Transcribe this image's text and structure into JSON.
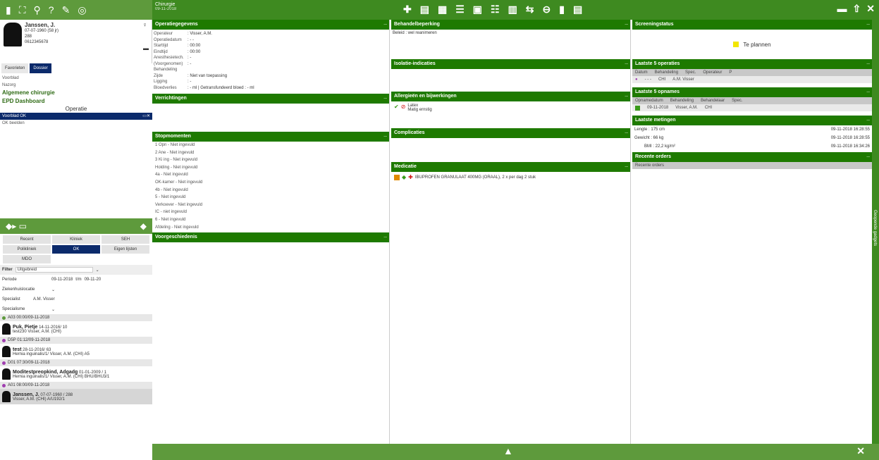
{
  "header": {
    "module": "Chirurgie",
    "date": "09-11-2018"
  },
  "patient": {
    "name": "Janssen, J.",
    "dob": "07-07-1960 (58 jr)",
    "bed": "288",
    "phone": "0612345678"
  },
  "left_tabs": [
    "Favorieten",
    "Dossier"
  ],
  "left_nav": {
    "items": [
      "Voorblad",
      "Nazorg"
    ],
    "sections": [
      "Algemene chirurgie",
      "EPD Dashboard"
    ],
    "section_title": "Operatie",
    "selected": "Voorblad OK",
    "sub_item": "OK beelden"
  },
  "worklist_buttons": [
    "Recent",
    "Kliniek",
    "SEH",
    "Polikliniek",
    "OK",
    "Eigen lijsten",
    "MDO"
  ],
  "filter": {
    "label": "Filter",
    "value": "Uitgebreid",
    "periode_label": "Periode",
    "periode_from": "09-11-2018",
    "periode_to_label": "t/m",
    "periode_to": "09-11-20",
    "location_label": "Ziekenhuislocatie",
    "specialist_label": "Specialist",
    "specialist_value": "A.M. Visser",
    "specialisme_label": "Specialisme"
  },
  "patient_list": [
    {
      "group": "A03 00:00/09-11-2018",
      "name": "Puk, Pietje",
      "extra": "14-11-2016/ 10",
      "sub": "test230 Visser, A.M. (CHI)"
    },
    {
      "group": "D5P 01:12/09-11-2018",
      "name": "test",
      "extra": "28-11-2016/ 63",
      "sub": "Hernia inguinalis/1/ Visser, A.M. (CHI) A5"
    },
    {
      "group": "D01 07:30/09-11-2018",
      "name": "Moditestpreopkind, Adgadg",
      "extra": "01-01-2009 / 1",
      "sub": "Hernia inguinalis/1/ Visser, A.M. (CHI) BHU/BHU3/1"
    },
    {
      "group": "A01 08:00/09-11-2018",
      "name": "Janssen, J.",
      "extra": "07-07-1960 / 288",
      "sub": "Visser, A.M. (CHI) A/U192/1"
    }
  ],
  "operatiegegevens": {
    "title": "Operatiegegevens",
    "rows": [
      {
        "k": "Operateur",
        "v": ": Visser, A.M."
      },
      {
        "k": "Operatiedatum",
        "v": ": - -"
      },
      {
        "k": "Starttijd",
        "v": ": 00:00"
      },
      {
        "k": "Eindtijd",
        "v": ": 00:00"
      },
      {
        "k": "Anesthesietech.",
        "v": ": -"
      },
      {
        "k": "(Voorgenomen) Behandeling",
        "v": ": -"
      },
      {
        "k": "Zijde",
        "v": ": Niet van toepassing"
      },
      {
        "k": "Ligging",
        "v": ": -"
      },
      {
        "k": "Bloedverlies",
        "v": ": - ml | Getransfundeerd bloed : - ml"
      }
    ]
  },
  "verrichtingen": {
    "title": "Verrichtingen"
  },
  "stopmomenten": {
    "title": "Stopmomenten",
    "items": [
      "1 Opn - Niet ingevuld",
      "2 Ane - Niet ingevuld",
      "3 Ki ing - Niet ingevuld",
      "Holding - Niet ingevuld",
      "4a - Niet ingevuld",
      "OK-kamer - Niet ingevuld",
      "4b - Niet ingevuld",
      "5 - Niet ingevuld",
      "Verkoever - Niet ingevuld",
      "IC - niet ingevuld",
      "6 - Niet ingevuld",
      "Afdeling - Niet ingevuld"
    ]
  },
  "voorgeschiedenis": {
    "title": "Voorgeschiedenis"
  },
  "behandelbeperking": {
    "title": "Behandelbeperking",
    "text": "Beleid : wel reanimeren"
  },
  "isolatie": {
    "title": "Isolatie-indicaties"
  },
  "allergie": {
    "title": "Allergieën en bijwerkingen",
    "item": "Latex",
    "severity": "Matig ernstig"
  },
  "complicaties": {
    "title": "Complicaties"
  },
  "medicatie": {
    "title": "Medicatie",
    "item": "IBUPROFEN GRANULAAT 400MG (ORAAL), 2 x per dag 2 stuk"
  },
  "screening": {
    "title": "Screeningstatus",
    "status": "Te plannen",
    "status_color": "#f2e600"
  },
  "operaties": {
    "title": "Laatste 5 operaties",
    "headers": [
      "Datum",
      "Behandeling",
      "Spec.",
      "Operateur",
      "P"
    ],
    "row": [
      "- - -",
      "",
      "CHI",
      "A.M. Visser"
    ]
  },
  "opnames": {
    "title": "Laatste 5 opnames",
    "headers": [
      "Opnamedatum",
      "Behandeling",
      "Behandelaar",
      "Spec."
    ],
    "row": [
      "09-11-2018",
      "",
      "Visser, A.M.",
      "CHI"
    ]
  },
  "metingen": {
    "title": "Laatste metingen",
    "rows": [
      {
        "label": "Lengte : 175 cm",
        "date": "09-11-2018 16:28:55"
      },
      {
        "label": "Gewicht : 66 kg",
        "date": "09-11-2018 16:28:55"
      },
      {
        "label": "BMI : 22,2 kg/m²",
        "date": "09-11-2018 16:34:26"
      }
    ]
  },
  "orders": {
    "title": "Recente orders",
    "header": "Recente orders"
  },
  "side_label": "Geopende gadgets",
  "colors": {
    "dark_green": "#1e7a00",
    "bar_green": "#5e9a3c",
    "navy": "#0b2a6b"
  }
}
